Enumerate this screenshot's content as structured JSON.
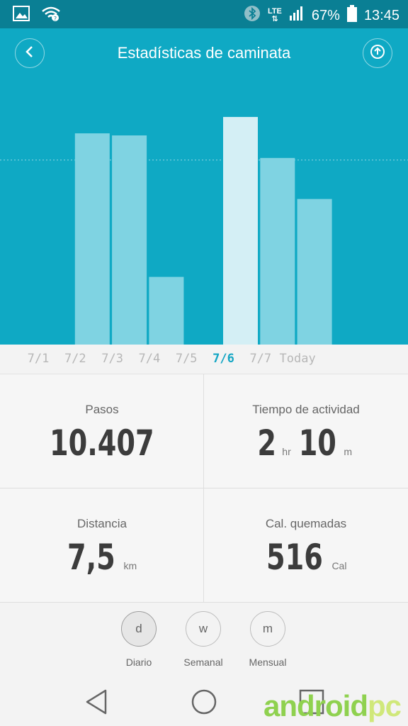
{
  "status_bar": {
    "battery": "67%",
    "time": "13:45",
    "network": "LTE",
    "icons": [
      "image-icon",
      "wifi-icon",
      "bluetooth-icon",
      "signal-icon",
      "battery-icon"
    ]
  },
  "header": {
    "title": "Estadísticas de caminata",
    "back_icon": "chevron-left-icon",
    "share_icon": "upload-icon"
  },
  "chart_data": {
    "type": "bar",
    "categories": [
      "7/1",
      "7/2",
      "7/3",
      "7/4",
      "7/5",
      "7/6",
      "7/7",
      "Today"
    ],
    "values": [
      0,
      10300,
      10200,
      3300,
      0,
      11100,
      9100,
      7100
    ],
    "selected": "7/6",
    "goal_line": 9000,
    "ylim": [
      0,
      13000
    ],
    "grid": false
  },
  "stats": {
    "steps": {
      "label": "Pasos",
      "value": "10.407"
    },
    "activity": {
      "label": "Tiempo de actividad",
      "hours": "2",
      "hours_unit": "hr",
      "minutes": "10",
      "minutes_unit": "m"
    },
    "distance": {
      "label": "Distancia",
      "value": "7,5",
      "unit": "km"
    },
    "calories": {
      "label": "Cal. quemadas",
      "value": "516",
      "unit": "Cal"
    }
  },
  "periods": [
    {
      "letter": "d",
      "label": "Diario",
      "selected": true
    },
    {
      "letter": "w",
      "label": "Semanal",
      "selected": false
    },
    {
      "letter": "m",
      "label": "Mensual",
      "selected": false
    }
  ],
  "navbar": {
    "icons": [
      "back-triangle-icon",
      "home-circle-icon",
      "recents-square-icon"
    ]
  },
  "watermark": {
    "part1": "android",
    "part2": "pc"
  },
  "colors": {
    "status": "#0a7f94",
    "primary": "#0fa9c4",
    "bar": "#7fd3e2",
    "bar_selected": "#d4eff5",
    "accent_text": "#14a6c4"
  }
}
